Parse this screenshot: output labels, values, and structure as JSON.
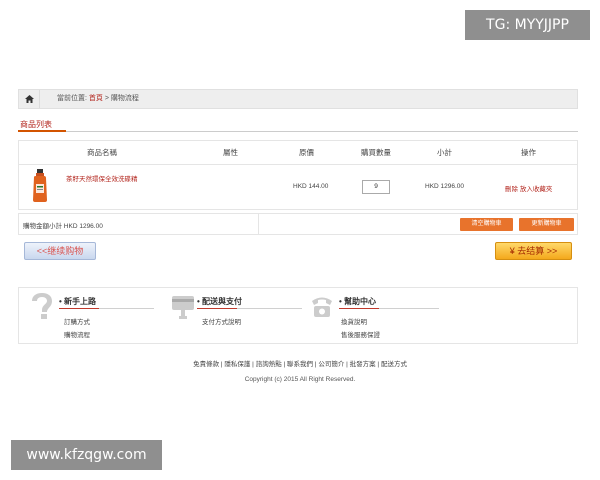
{
  "watermarks": {
    "top": "TG: MYYJJPP",
    "bottom": "www.kfzqgw.com"
  },
  "breadcrumb": {
    "prefix": "當前位置:",
    "home": "首頁",
    "separator": ">",
    "current": "購物流程"
  },
  "section": {
    "title": "商品列表"
  },
  "table": {
    "headers": [
      "商品名稱",
      "屬性",
      "原價",
      "購買數量",
      "小計",
      "操作"
    ],
    "rows": [
      {
        "name": "茶籽天然環保全效洗碟精",
        "price": "HKD 144.00",
        "quantity": "9",
        "subtotal": "HKD 1296.00",
        "actions": {
          "delete": "刪除",
          "favorite": "放入收藏夾"
        }
      }
    ]
  },
  "summary": {
    "total_text": "購物金額小計 HKD 1296.00",
    "clear_button": "清空購物車",
    "update_button": "更新購物車"
  },
  "buttons": {
    "continue": "<<继续购物",
    "checkout": "¥ 去结算 >>"
  },
  "help": [
    {
      "icon": "question-icon",
      "title": "新手上路",
      "links": [
        "訂購方式",
        "購物流程"
      ]
    },
    {
      "icon": "delivery-card-icon",
      "title": "配送與支付",
      "links": [
        "支付方式說明"
      ]
    },
    {
      "icon": "phone-icon",
      "title": "幫助中心",
      "links": [
        "換貨說明",
        "售後服務保證"
      ]
    }
  ],
  "footer": {
    "links": [
      "免責條款",
      "隱私保護",
      "諮詢熱點",
      "聯系我們",
      "公司簡介",
      "批發方案",
      "配送方式"
    ],
    "copyright": "Copyright (c) 2015 All Right Reserved."
  },
  "colors": {
    "accent_red": "#b3261e",
    "orange_button": "#e8732c",
    "checkout_yellow": "#f4a81c"
  }
}
